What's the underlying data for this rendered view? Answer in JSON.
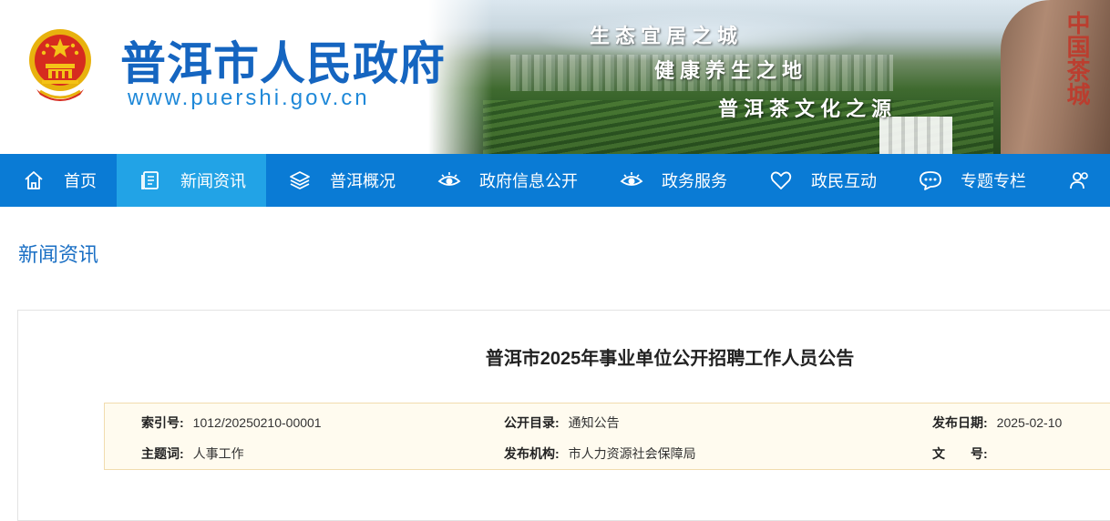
{
  "header": {
    "site_title": "普洱市人民政府",
    "site_url": "www.puershi.gov.cn",
    "slogans": [
      "生态宜居之城",
      "健康养生之地",
      "普洱茶文化之源"
    ],
    "rock_inscription": "中国茶城"
  },
  "nav": {
    "items": [
      {
        "label": "首页",
        "icon": "home-icon"
      },
      {
        "label": "新闻资讯",
        "icon": "news-icon",
        "active": true
      },
      {
        "label": "普洱概况",
        "icon": "layers-icon"
      },
      {
        "label": "政府信息公开",
        "icon": "eye-icon"
      },
      {
        "label": "政务服务",
        "icon": "eye-icon"
      },
      {
        "label": "政民互动",
        "icon": "heart-icon"
      },
      {
        "label": "专题专栏",
        "icon": "chat-icon"
      }
    ]
  },
  "section": {
    "title": "新闻资讯"
  },
  "article": {
    "title": "普洱市2025年事业单位公开招聘工作人员公告",
    "meta": {
      "index_label": "索引号:",
      "index_value": "1012/20250210-00001",
      "catalog_label": "公开目录:",
      "catalog_value": "通知公告",
      "date_label": "发布日期:",
      "date_value": "2025-02-10",
      "subject_label": "主题词:",
      "subject_value": "人事工作",
      "org_label": "发布机构:",
      "org_value": "市人力资源社会保障局",
      "doc_label": "文　　号:",
      "doc_value": ""
    }
  },
  "colors": {
    "nav_bg": "#0a7bd5",
    "nav_active": "#22a3e6",
    "title_blue": "#1565c0",
    "meta_bg": "#fffbef",
    "meta_border": "#f1dcae"
  }
}
